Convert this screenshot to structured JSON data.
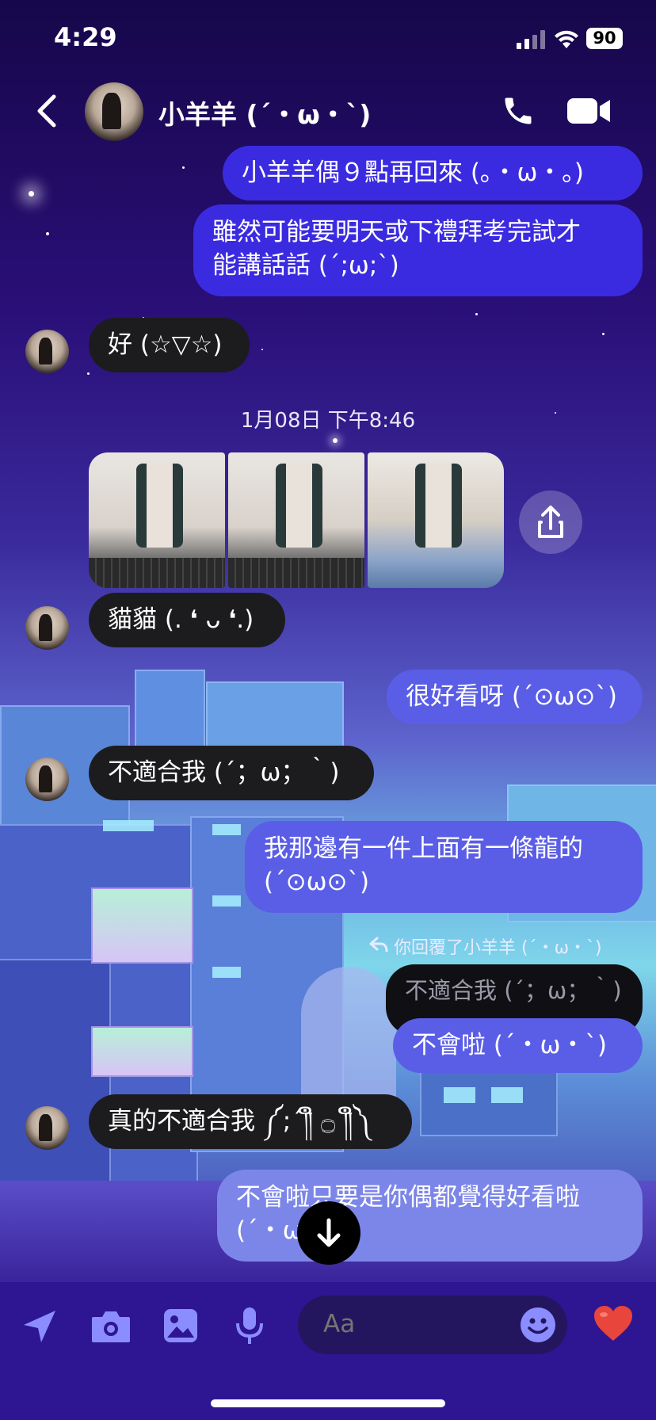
{
  "status_bar": {
    "time": "4:29",
    "battery": "90"
  },
  "header": {
    "contact_name": "小羊羊 (´・ω・`)"
  },
  "date_separator": "1月08日 下午8:46",
  "messages": [
    {
      "text": "小羊羊偶９點再回來 (｡・ω・｡)"
    },
    {
      "text": "雖然可能要明天或下禮拜考完試才\n能講話話 (´;ω;`)"
    },
    {
      "text": "好 (☆▽☆)"
    },
    {
      "text": "貓貓 (. ❛ ᴗ ❛.)"
    },
    {
      "text": "很好看呀 (´⊙ω⊙`)"
    },
    {
      "text": "不適合我 (´；ω；｀)"
    },
    {
      "text": "我那邊有一件上面有一條龍的\n(´⊙ω⊙`)"
    },
    {
      "text": "不適合我 (´；ω；｀)"
    },
    {
      "text": "不會啦 (´・ω・`)"
    },
    {
      "text": "真的不適合我 ༼;´༎ຶ ۝ ༎ຶ༽"
    },
    {
      "text": "不會啦只要是你偶都覺得好看啦\n(´・ω・`)"
    }
  ],
  "reply_label": "你回覆了小羊羊 (´・ω・`)",
  "composer": {
    "placeholder": "Aa"
  },
  "colors": {
    "outgoing": "#3b2be0",
    "incoming": "#1c1c1e",
    "like_heart": "#e8453c"
  },
  "icons": [
    "back-chevron-icon",
    "phone-icon",
    "video-camera-icon",
    "share-icon",
    "reply-arrow-icon",
    "arrow-down-icon",
    "send-location-icon",
    "camera-icon",
    "gallery-icon",
    "microphone-icon",
    "emoji-icon",
    "heart-icon"
  ]
}
